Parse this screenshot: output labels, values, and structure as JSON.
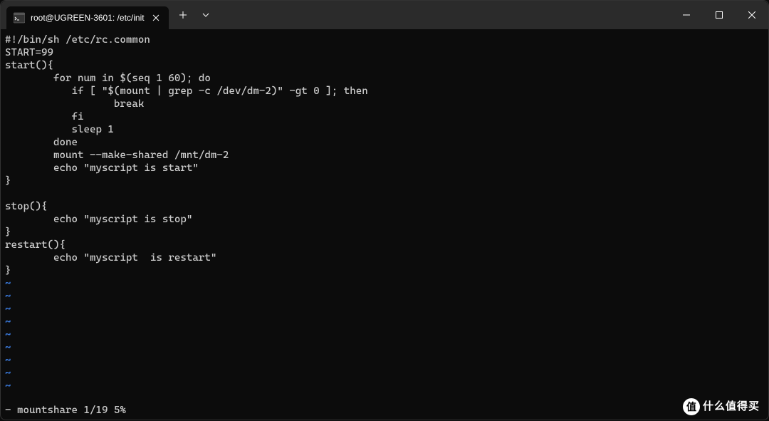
{
  "titlebar": {
    "tab": {
      "title": "root@UGREEN-3601: /etc/init"
    }
  },
  "terminal": {
    "lines": [
      "#!/bin/sh /etc/rc.common",
      "START=99",
      "start(){",
      "        for num in $(seq 1 60); do",
      "           if [ \"$(mount | grep -c /dev/dm-2)\" -gt 0 ]; then",
      "                  break",
      "           fi",
      "           sleep 1",
      "        done",
      "        mount --make-shared /mnt/dm-2",
      "        echo \"myscript is start\"",
      "}",
      "",
      "stop(){",
      "        echo \"myscript is stop\"",
      "}",
      "restart(){",
      "        echo \"myscript  is restart\"",
      "}"
    ],
    "tilde_count": 9,
    "status": "- mountshare 1/19 5%"
  },
  "watermark": {
    "badge": "值",
    "text": "什么值得买"
  }
}
